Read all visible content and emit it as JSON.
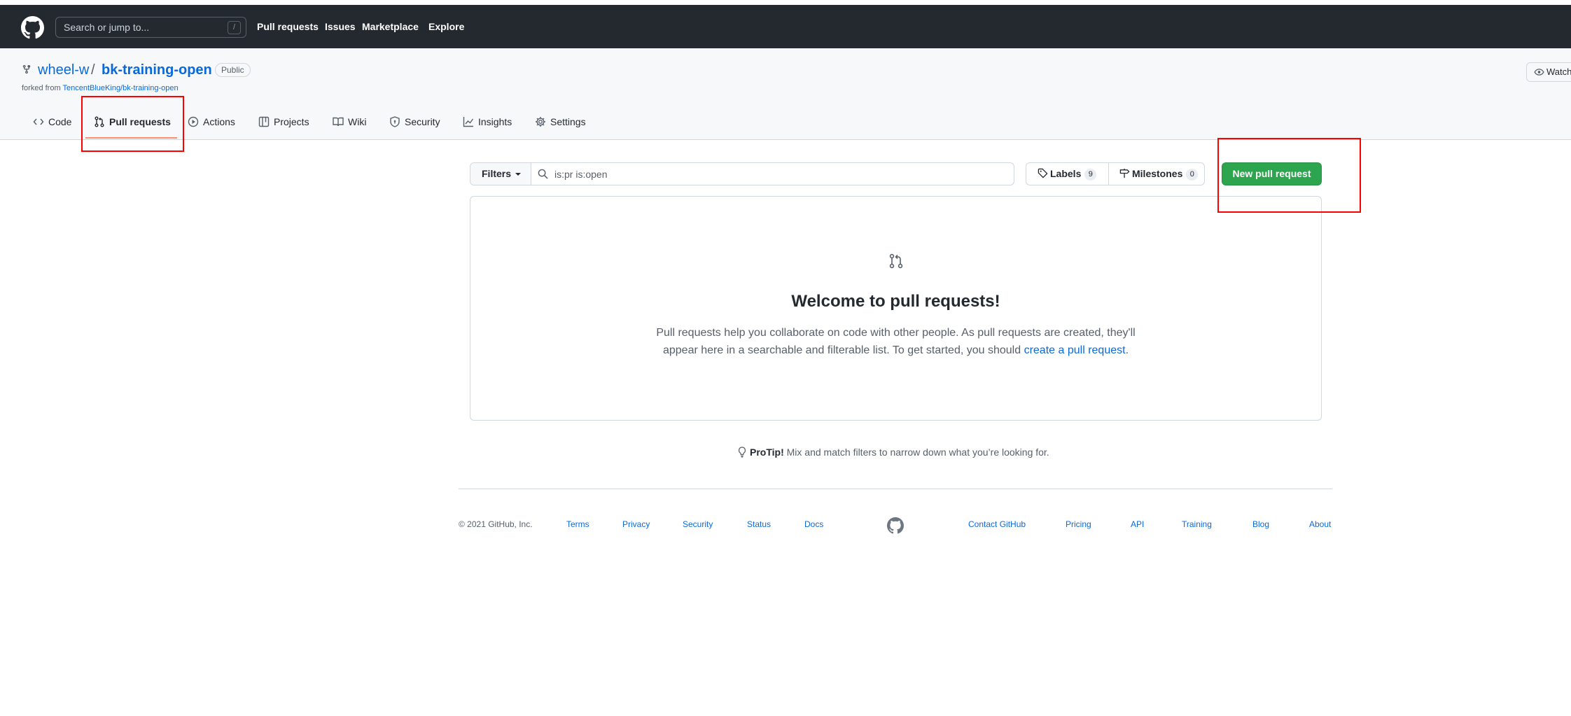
{
  "header": {
    "search_placeholder": "Search or jump to...",
    "search_shortcut": "/",
    "nav": [
      "Pull requests",
      "Issues",
      "Marketplace",
      "Explore"
    ]
  },
  "repo": {
    "owner": "wheel-w",
    "separator": "/",
    "name": "bk-training-open",
    "visibility": "Public",
    "forked_prefix": "forked from ",
    "forked_source": "TencentBlueKing/bk-training-open",
    "watch_label": "Watch"
  },
  "tabs": [
    {
      "label": "Code",
      "icon": "code-icon"
    },
    {
      "label": "Pull requests",
      "icon": "git-pull-request-icon",
      "selected": true
    },
    {
      "label": "Actions",
      "icon": "play-icon"
    },
    {
      "label": "Projects",
      "icon": "table-icon"
    },
    {
      "label": "Wiki",
      "icon": "book-icon"
    },
    {
      "label": "Security",
      "icon": "shield-icon"
    },
    {
      "label": "Insights",
      "icon": "graph-icon"
    },
    {
      "label": "Settings",
      "icon": "gear-icon"
    }
  ],
  "toolbar": {
    "filters_label": "Filters",
    "search_value": "is:pr is:open",
    "labels_label": "Labels",
    "labels_count": "9",
    "milestones_label": "Milestones",
    "milestones_count": "0",
    "new_pr_label": "New pull request"
  },
  "blankslate": {
    "title": "Welcome to pull requests!",
    "desc_part1": "Pull requests help you collaborate on code with other people. As pull requests are created, they'll appear here in a searchable and filterable list. To get started, you should ",
    "desc_link": "create a pull request",
    "desc_end": "."
  },
  "protip": {
    "strong": "ProTip!",
    "text": " Mix and match filters to narrow down what you’re looking for."
  },
  "footer": {
    "copyright": "© 2021 GitHub, Inc.",
    "left_links": [
      "Terms",
      "Privacy",
      "Security",
      "Status",
      "Docs"
    ],
    "right_links": [
      "Contact GitHub",
      "Pricing",
      "API",
      "Training",
      "Blog",
      "About"
    ]
  },
  "colors": {
    "header_bg": "#24292f",
    "link": "#0969da",
    "primary_button": "#2da44e",
    "tab_underline": "#fd8c73",
    "annotation": "#ff0000"
  }
}
